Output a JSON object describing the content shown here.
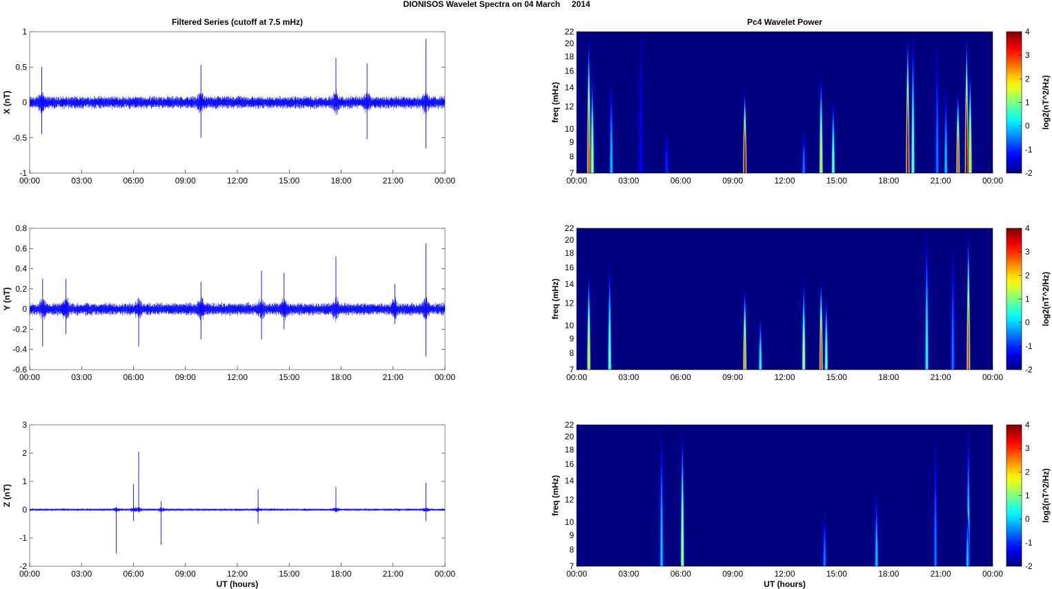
{
  "title": "DIONISOS Wavelet Spectra on 04 March     2014",
  "chart_data": [
    {
      "type": "line",
      "title": "Filtered Series (cutoff at 7.5 mHz)",
      "ylabel": "X (nT)",
      "xlabel": "",
      "ylim": [
        -1,
        1
      ],
      "yticks": [
        "-1",
        "-0.5",
        "0",
        "0.5",
        "1"
      ],
      "ytick_values": [
        -1,
        -0.5,
        0,
        0.5,
        1
      ],
      "xticks": [
        "00:00",
        "03:00",
        "06:00",
        "09:00",
        "12:00",
        "15:00",
        "18:00",
        "21:00",
        "00:00"
      ],
      "xlim_hours": [
        0,
        24
      ],
      "color": "#0000ff",
      "noise_amplitude": 0.1,
      "spikes": [
        {
          "t": 0.7,
          "max": 0.5,
          "min": -0.45
        },
        {
          "t": 9.9,
          "max": 0.53,
          "min": -0.5
        },
        {
          "t": 17.7,
          "max": 0.63,
          "min": -0.1
        },
        {
          "t": 19.5,
          "max": 0.55,
          "min": -0.52
        },
        {
          "t": 22.9,
          "max": 0.9,
          "min": -0.65
        }
      ]
    },
    {
      "type": "line",
      "title": "",
      "ylabel": "Y (nT)",
      "xlabel": "",
      "ylim": [
        -0.6,
        0.8
      ],
      "yticks": [
        "-0.6",
        "-0.4",
        "-0.2",
        "0",
        "0.2",
        "0.4",
        "0.6",
        "0.8"
      ],
      "ytick_values": [
        -0.6,
        -0.4,
        -0.2,
        0,
        0.2,
        0.4,
        0.6,
        0.8
      ],
      "xticks": [
        "00:00",
        "03:00",
        "06:00",
        "09:00",
        "12:00",
        "15:00",
        "18:00",
        "21:00",
        "00:00"
      ],
      "xlim_hours": [
        0,
        24
      ],
      "color": "#0000ff",
      "noise_amplitude": 0.07,
      "spikes": [
        {
          "t": 0.75,
          "max": 0.3,
          "min": -0.37
        },
        {
          "t": 2.1,
          "max": 0.3,
          "min": -0.25
        },
        {
          "t": 6.3,
          "max": 0.1,
          "min": -0.37
        },
        {
          "t": 9.9,
          "max": 0.27,
          "min": -0.3
        },
        {
          "t": 13.4,
          "max": 0.38,
          "min": -0.3
        },
        {
          "t": 14.7,
          "max": 0.36,
          "min": -0.2
        },
        {
          "t": 17.7,
          "max": 0.52,
          "min": -0.1
        },
        {
          "t": 21.1,
          "max": 0.25,
          "min": -0.15
        },
        {
          "t": 22.9,
          "max": 0.65,
          "min": -0.47
        }
      ]
    },
    {
      "type": "line",
      "title": "",
      "ylabel": "Z (nT)",
      "xlabel": "UT (hours)",
      "ylim": [
        -2,
        3
      ],
      "yticks": [
        "-2",
        "-1",
        "0",
        "1",
        "2",
        "3"
      ],
      "ytick_values": [
        -2,
        -1,
        0,
        1,
        2,
        3
      ],
      "xticks": [
        "00:00",
        "03:00",
        "06:00",
        "09:00",
        "12:00",
        "15:00",
        "18:00",
        "21:00",
        "00:00"
      ],
      "xlim_hours": [
        0,
        24
      ],
      "color": "#0000ff",
      "noise_amplitude": 0.05,
      "spikes": [
        {
          "t": 5.0,
          "max": 0.1,
          "min": -1.55
        },
        {
          "t": 6.0,
          "max": 0.9,
          "min": -0.4
        },
        {
          "t": 6.3,
          "max": 2.05,
          "min": -0.1
        },
        {
          "t": 7.6,
          "max": 0.3,
          "min": -1.25
        },
        {
          "t": 13.2,
          "max": 0.72,
          "min": -0.5
        },
        {
          "t": 17.7,
          "max": 0.8,
          "min": -0.1
        },
        {
          "t": 22.9,
          "max": 0.95,
          "min": -0.4
        }
      ]
    },
    {
      "type": "heatmap",
      "title": "Pc4 Wavelet Power",
      "ylabel": "freq (mHz)",
      "xlabel": "",
      "ylim": [
        7,
        22
      ],
      "yscale": "log",
      "yticks": [
        "7",
        "8",
        "9",
        "10",
        "12",
        "14",
        "16",
        "18",
        "20",
        "22"
      ],
      "ytick_values": [
        7,
        8,
        9,
        10,
        12,
        14,
        16,
        18,
        20,
        22
      ],
      "xticks": [
        "00:00",
        "03:00",
        "06:00",
        "09:00",
        "12:00",
        "15:00",
        "18:00",
        "21:00",
        "00:00"
      ],
      "clim": [
        -2,
        4
      ],
      "colorbar_label": "log2(nT^2/Hz)",
      "colorbar_ticks": [
        "-2",
        "-1",
        "0",
        "1",
        "2",
        "3",
        "4"
      ],
      "colormap": "jet",
      "events": [
        {
          "t": 0.7,
          "peak": 3,
          "fmax": 22
        },
        {
          "t": 0.9,
          "peak": 1.5,
          "fmax": 16
        },
        {
          "t": 2.0,
          "peak": 0,
          "fmax": 15
        },
        {
          "t": 3.7,
          "peak": -1.3,
          "fmax": 22
        },
        {
          "t": 5.2,
          "peak": -1,
          "fmax": 10
        },
        {
          "t": 9.7,
          "peak": 4,
          "fmax": 14
        },
        {
          "t": 13.1,
          "peak": -0.5,
          "fmax": 10
        },
        {
          "t": 14.1,
          "peak": 2,
          "fmax": 16
        },
        {
          "t": 14.8,
          "peak": 1,
          "fmax": 13
        },
        {
          "t": 19.1,
          "peak": 4,
          "fmax": 22
        },
        {
          "t": 19.4,
          "peak": 1,
          "fmax": 22
        },
        {
          "t": 20.8,
          "peak": -0.5,
          "fmax": 20
        },
        {
          "t": 21.3,
          "peak": 0,
          "fmax": 14
        },
        {
          "t": 22.0,
          "peak": 3,
          "fmax": 14
        },
        {
          "t": 22.5,
          "peak": 4,
          "fmax": 22
        },
        {
          "t": 22.7,
          "peak": 2,
          "fmax": 17
        }
      ]
    },
    {
      "type": "heatmap",
      "title": "",
      "ylabel": "freq (mHz)",
      "xlabel": "",
      "ylim": [
        7,
        22
      ],
      "yscale": "log",
      "yticks": [
        "7",
        "8",
        "9",
        "10",
        "12",
        "14",
        "16",
        "18",
        "20",
        "22"
      ],
      "ytick_values": [
        7,
        8,
        9,
        10,
        12,
        14,
        16,
        18,
        20,
        22
      ],
      "xticks": [
        "00:00",
        "03:00",
        "06:00",
        "09:00",
        "12:00",
        "15:00",
        "18:00",
        "21:00",
        "00:00"
      ],
      "clim": [
        -2,
        4
      ],
      "colorbar_label": "log2(nT^2/Hz)",
      "colorbar_ticks": [
        "-2",
        "-1",
        "0",
        "1",
        "2",
        "3",
        "4"
      ],
      "colormap": "jet",
      "events": [
        {
          "t": 0.7,
          "peak": 2,
          "fmax": 16
        },
        {
          "t": 1.9,
          "peak": 1,
          "fmax": 17
        },
        {
          "t": 9.7,
          "peak": 2.5,
          "fmax": 14
        },
        {
          "t": 10.6,
          "peak": 0.5,
          "fmax": 11
        },
        {
          "t": 13.1,
          "peak": 1.5,
          "fmax": 15
        },
        {
          "t": 14.1,
          "peak": 3,
          "fmax": 15
        },
        {
          "t": 14.4,
          "peak": 1,
          "fmax": 13
        },
        {
          "t": 20.2,
          "peak": 0.5,
          "fmax": 22
        },
        {
          "t": 21.7,
          "peak": -0.5,
          "fmax": 20
        },
        {
          "t": 22.6,
          "peak": 3,
          "fmax": 22
        }
      ]
    },
    {
      "type": "heatmap",
      "title": "",
      "ylabel": "freq (mHz)",
      "xlabel": "UT (hours)",
      "ylim": [
        7,
        22
      ],
      "yscale": "log",
      "yticks": [
        "7",
        "8",
        "9",
        "10",
        "12",
        "14",
        "16",
        "18",
        "20",
        "22"
      ],
      "ytick_values": [
        7,
        8,
        9,
        10,
        12,
        14,
        16,
        18,
        20,
        22
      ],
      "xticks": [
        "00:00",
        "03:00",
        "06:00",
        "09:00",
        "12:00",
        "15:00",
        "18:00",
        "21:00",
        "00:00"
      ],
      "clim": [
        -2,
        4
      ],
      "colorbar_label": "log2(nT^2/Hz)",
      "colorbar_ticks": [
        "-2",
        "-1",
        "0",
        "1",
        "2",
        "3",
        "4"
      ],
      "colormap": "jet",
      "events": [
        {
          "t": 4.9,
          "peak": 0,
          "fmax": 22
        },
        {
          "t": 6.1,
          "peak": 1.5,
          "fmax": 22
        },
        {
          "t": 14.3,
          "peak": -0.5,
          "fmax": 11
        },
        {
          "t": 17.3,
          "peak": 0,
          "fmax": 13
        },
        {
          "t": 20.7,
          "peak": -0.5,
          "fmax": 20
        },
        {
          "t": 22.6,
          "peak": 0.5,
          "fmax": 22
        },
        {
          "t": 22.55,
          "peak": 0,
          "fmax": 11
        }
      ]
    }
  ]
}
